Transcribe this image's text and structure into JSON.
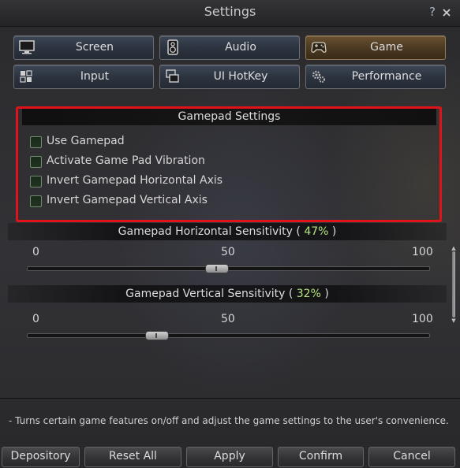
{
  "window": {
    "title": "Settings",
    "help_label": "?",
    "close_label": "X"
  },
  "tabs": [
    {
      "label": "Screen",
      "icon": "monitor-icon",
      "active": false
    },
    {
      "label": "Audio",
      "icon": "speaker-icon",
      "active": false
    },
    {
      "label": "Game",
      "icon": "gamepad-icon",
      "active": true
    },
    {
      "label": "Input",
      "icon": "keyboard-icon",
      "active": false
    },
    {
      "label": "UI HotKey",
      "icon": "windows-icon",
      "active": false
    },
    {
      "label": "Performance",
      "icon": "gears-icon",
      "active": false
    }
  ],
  "gamepad": {
    "header": "Gamepad Settings",
    "options": [
      {
        "label": "Use Gamepad",
        "checked": false
      },
      {
        "label": "Activate Game Pad Vibration",
        "checked": false
      },
      {
        "label": "Invert Gamepad Horizontal Axis",
        "checked": false
      },
      {
        "label": "Invert Gamepad Vertical Axis",
        "checked": false
      }
    ]
  },
  "sliders": [
    {
      "title_prefix": "Gamepad Horizontal Sensitivity ( ",
      "percent": "47%",
      "title_suffix": " )",
      "value_fraction": 0.47,
      "ticks": [
        "0",
        "50",
        "100"
      ]
    },
    {
      "title_prefix": "Gamepad Vertical Sensitivity ( ",
      "percent": "32%",
      "title_suffix": " )",
      "value_fraction": 0.32,
      "ticks": [
        "0",
        "50",
        "100"
      ]
    }
  ],
  "footer": {
    "description": "- Turns certain game features on/off and adjust the game settings to the user's convenience.",
    "buttons": [
      "Depository",
      "Reset All",
      "Apply",
      "Confirm",
      "Cancel"
    ]
  },
  "colors": {
    "accent_percent": "#b4e37a",
    "highlight_border": "#e0131b",
    "active_tab": "#6a5130"
  }
}
